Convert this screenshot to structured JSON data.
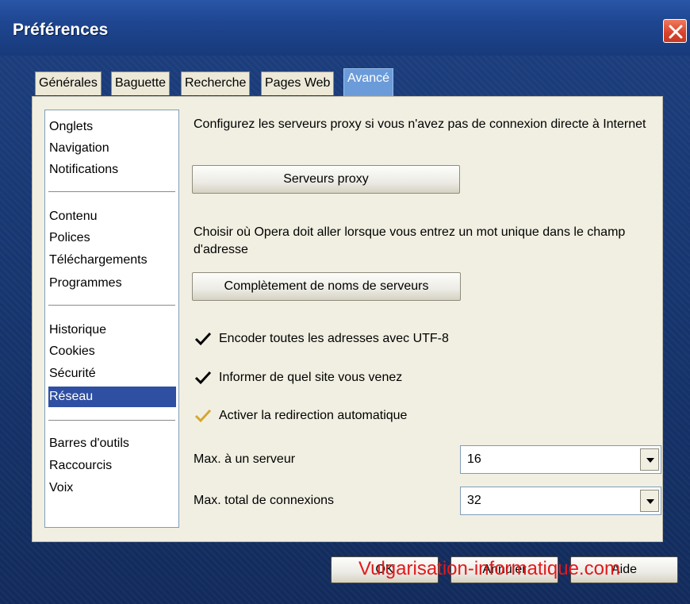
{
  "window": {
    "title": "Préférences"
  },
  "tabs": [
    {
      "label": "Générales",
      "active": false
    },
    {
      "label": "Baguette",
      "active": false
    },
    {
      "label": "Recherche",
      "active": false
    },
    {
      "label": "Pages Web",
      "active": false
    },
    {
      "label": "Avancé",
      "active": true
    }
  ],
  "sidebar": {
    "groups": [
      [
        "Onglets",
        "Navigation",
        "Notifications"
      ],
      [
        "Contenu",
        "Polices",
        "Téléchargements",
        "Programmes"
      ],
      [
        "Historique",
        "Cookies",
        "Sécurité",
        "Réseau"
      ],
      [
        "Barres d'outils",
        "Raccourcis",
        "Voix"
      ]
    ],
    "selected": "Réseau"
  },
  "content": {
    "proxy_text": "Configurez les serveurs proxy si vous n'avez pas de connexion directe à Internet",
    "proxy_button": "Serveurs proxy",
    "completion_text": "Choisir où Opera doit aller lorsque vous entrez un mot unique dans le champ d'adresse",
    "completion_button": "Complètement de noms de serveurs",
    "checkboxes": [
      {
        "label": "Encoder toutes les adresses avec UTF-8",
        "checked": true
      },
      {
        "label": "Informer de quel site vous venez",
        "checked": true
      },
      {
        "label": "Activer la redirection automatique",
        "checked": true
      }
    ],
    "max_server_label": "Max. à un serveur",
    "max_server_value": "16",
    "max_total_label": "Max. total de connexions",
    "max_total_value": "32"
  },
  "footer": {
    "ok": "OK",
    "cancel": "Annuler",
    "help": "Aide"
  },
  "watermark": "Vulgarisation-informatique.com",
  "colors": {
    "accent": "#2f4fa3",
    "title_bar": "#1e4690",
    "close_red": "#d9412b",
    "watermark_red": "#e2191c"
  }
}
